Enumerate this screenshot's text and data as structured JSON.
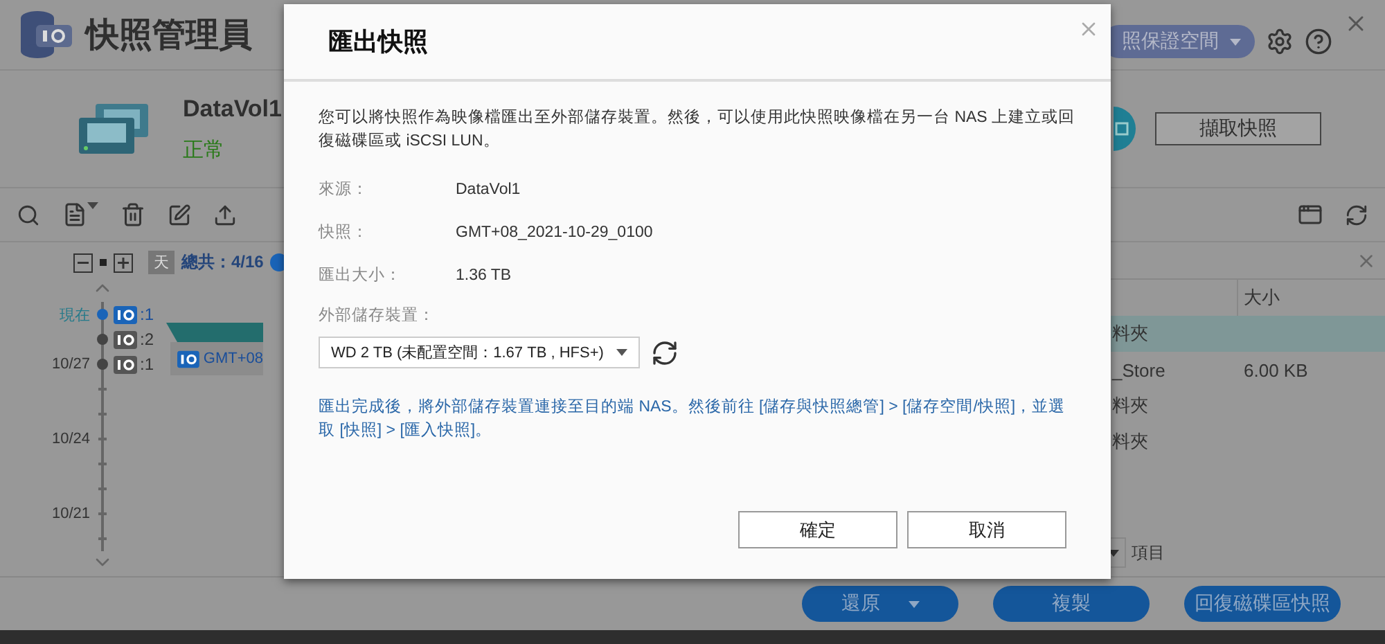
{
  "app": {
    "title": "快照管理員",
    "pill": "照保證空間",
    "volume": {
      "name": "DataVol1",
      "status": "正常"
    },
    "snapshot_button": "擷取快照",
    "timeline": {
      "day_label": "天",
      "total": "總共：4/16",
      "rows": [
        {
          "kind": "snapshot",
          "date": "現在",
          "count": ":1",
          "current": true
        },
        {
          "kind": "snapshot",
          "count": ":2",
          "current": false
        },
        {
          "kind": "snapshot",
          "date": "10/27",
          "count": ":1",
          "current": false
        },
        {
          "kind": "tick"
        },
        {
          "kind": "tick"
        },
        {
          "kind": "tick",
          "date": "10/24"
        },
        {
          "kind": "tick"
        },
        {
          "kind": "tick"
        },
        {
          "kind": "tick",
          "date": "10/21"
        },
        {
          "kind": "tick"
        }
      ],
      "card": {
        "label": "GMT+08"
      }
    },
    "file_table": {
      "columns": [
        "大小"
      ],
      "rows": [
        {
          "name": "料夾",
          "selected": true
        },
        {
          "name": "_Store",
          "size": "6.00 KB",
          "selected": false
        },
        {
          "name": "料夾",
          "selected": false
        },
        {
          "name": "料夾",
          "selected": false
        }
      ]
    },
    "items_label": "項目",
    "footer_buttons": [
      {
        "label": "還原",
        "dropdown": true
      },
      {
        "label": "複製",
        "dropdown": false
      },
      {
        "label": "回復磁碟區快照",
        "dropdown": false
      }
    ]
  },
  "dialog": {
    "title": "匯出快照",
    "description": "您可以將快照作為映像檔匯出至外部儲存裝置。然後，可以使用此快照映像檔在另一台 NAS 上建立或回復磁碟區或 iSCSI LUN。",
    "fields": [
      {
        "label": "來源：",
        "value": "DataVol1"
      },
      {
        "label": "快照：",
        "value": "GMT+08_2021-10-29_0100"
      },
      {
        "label": "匯出大小：",
        "value": "1.36 TB"
      }
    ],
    "device_label": "外部儲存裝置：",
    "device_value": "WD 2 TB (未配置空間：1.67 TB , HFS+)",
    "note": "匯出完成後，將外部儲存裝置連接至目的端 NAS。然後前往 [儲存與快照總管] > [儲存空間/快照]，並選取 [快照] > [匯入快照]。",
    "buttons": [
      "確定",
      "取消"
    ]
  }
}
